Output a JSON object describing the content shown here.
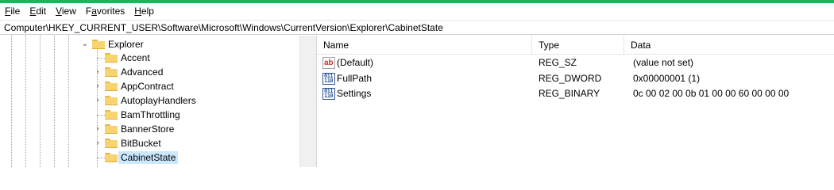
{
  "menu": [
    {
      "accel": "F",
      "rest": "ile"
    },
    {
      "accel": "E",
      "rest": "dit"
    },
    {
      "accel": "V",
      "rest": "iew"
    },
    {
      "accel": "",
      "pre": "F",
      "accel2": "a",
      "rest": "vorites"
    },
    {
      "accel": "H",
      "rest": "elp"
    }
  ],
  "menu_labels": {
    "file_a": "F",
    "file_b": "ile",
    "edit_a": "E",
    "edit_b": "dit",
    "view_a": "V",
    "view_b": "iew",
    "fav_a": "F",
    "fav_u": "a",
    "fav_b": "vorites",
    "help_a": "H",
    "help_b": "elp"
  },
  "address": "Computer\\HKEY_CURRENT_USER\\Software\\Microsoft\\Windows\\CurrentVersion\\Explorer\\CabinetState",
  "tree": {
    "parent": "Explorer",
    "children": [
      "Accent",
      "Advanced",
      "AppContract",
      "AutoplayHandlers",
      "BamThrottling",
      "BannerStore",
      "BitBucket",
      "CabinetState"
    ],
    "selected": "CabinetState"
  },
  "list": {
    "columns": [
      "Name",
      "Type",
      "Data"
    ],
    "rows": [
      {
        "icon": "string-value-icon",
        "name": "(Default)",
        "type": "REG_SZ",
        "data": "(value not set)"
      },
      {
        "icon": "binary-value-icon",
        "name": "FullPath",
        "type": "REG_DWORD",
        "data": "0x00000001 (1)"
      },
      {
        "icon": "binary-value-icon",
        "name": "Settings",
        "type": "REG_BINARY",
        "data": "0c 00 02 00 0b 01 00 00 60 00 00 00"
      }
    ]
  },
  "colors": {
    "accent_stripe": "#21b25a",
    "selection": "#cce8ff",
    "folder": "#f8d471"
  }
}
